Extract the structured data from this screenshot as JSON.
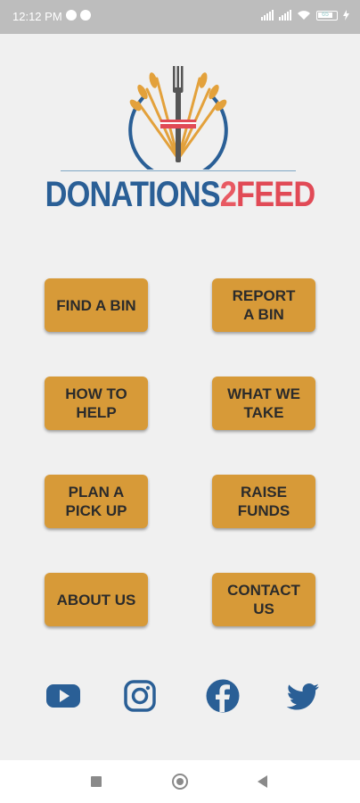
{
  "status_bar": {
    "time": "12:12 PM",
    "battery_level": "65"
  },
  "logo": {
    "part1": "DONATIONS",
    "number": "2",
    "part2": "FEED"
  },
  "menu": {
    "find_a_bin": "FIND A BIN",
    "report_a_bin": "REPORT\nA BIN",
    "how_to_help": "HOW TO\nHELP",
    "what_we_take": "WHAT WE\nTAKE",
    "plan_a_pick_up": "PLAN A\nPICK UP",
    "raise_funds": "RAISE\nFUNDS",
    "about_us": "ABOUT US",
    "contact_us": "CONTACT\nUS"
  },
  "social": [
    "youtube-icon",
    "instagram-icon",
    "facebook-icon",
    "twitter-icon"
  ],
  "colors": {
    "button": "#d79a38",
    "brand_blue": "#2a5f96",
    "brand_red": "#e14a56",
    "background": "#f0f0f0",
    "status_bar": "#bdbdbd"
  }
}
